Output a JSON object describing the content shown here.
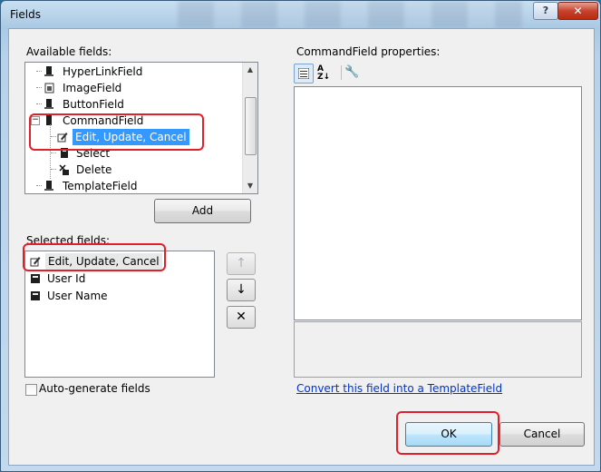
{
  "window": {
    "title": "Fields",
    "help_label": "?",
    "close_label": "✕"
  },
  "available": {
    "label": "Available fields:",
    "items": [
      {
        "label": "HyperLinkField",
        "icon": "hyperlink-field-icon"
      },
      {
        "label": "ImageField",
        "icon": "image-field-icon"
      },
      {
        "label": "ButtonField",
        "icon": "button-field-icon"
      },
      {
        "label": "CommandField",
        "icon": "command-field-icon",
        "expanded": true
      },
      {
        "label": "Edit, Update, Cancel",
        "icon": "edit-pencil-icon",
        "selected": true
      },
      {
        "label": "Select",
        "icon": "select-field-icon"
      },
      {
        "label": "Delete",
        "icon": "delete-x-icon"
      },
      {
        "label": "TemplateField",
        "icon": "template-field-icon"
      }
    ],
    "add_label": "Add"
  },
  "selected": {
    "label": "Selected fields:",
    "items": [
      {
        "label": "Edit, Update, Cancel",
        "icon": "edit-pencil-icon",
        "selected": true
      },
      {
        "label": "User Id",
        "icon": "bound-field-icon"
      },
      {
        "label": "User Name",
        "icon": "bound-field-icon"
      }
    ]
  },
  "autogen": {
    "label": "Auto-generate fields",
    "checked": false
  },
  "properties": {
    "label": "CommandField properties:",
    "convert_link": "Convert this field into a TemplateField"
  },
  "footer": {
    "ok_label": "OK",
    "cancel_label": "Cancel"
  },
  "colors": {
    "highlight_outline": "#e0202a",
    "selection": "#3399ff",
    "link": "#0033cc"
  }
}
